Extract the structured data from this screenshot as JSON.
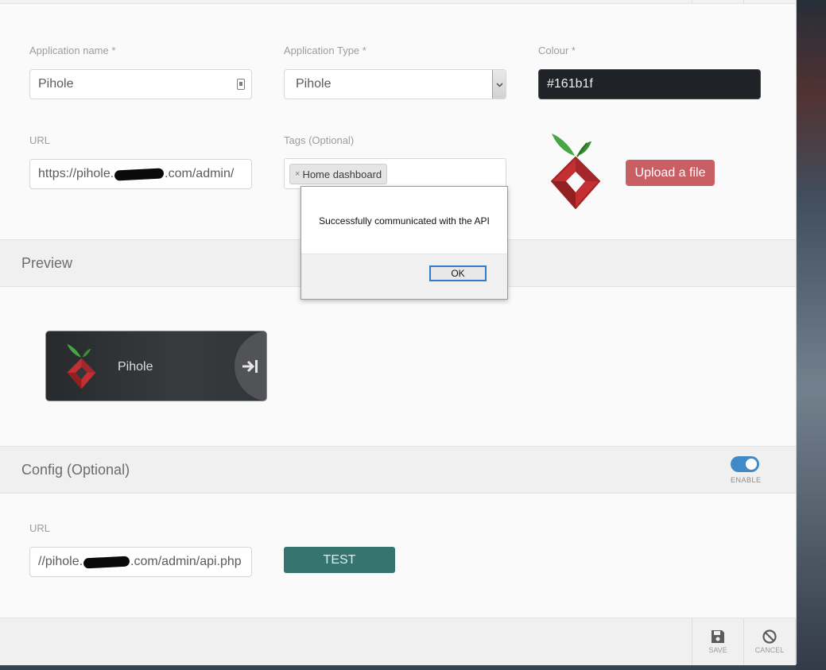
{
  "form": {
    "app_name_label": "Application name *",
    "app_name_value": "Pihole",
    "app_type_label": "Application Type *",
    "app_type_value": "Pihole",
    "colour_label": "Colour *",
    "colour_value": "#161b1f",
    "url_label": "URL",
    "url_prefix": "https://pihole.",
    "url_suffix": ".com/admin/",
    "tags_label": "Tags (Optional)",
    "tags": [
      "Home dashboard"
    ],
    "tag_remove": "×",
    "upload_label": "Upload a file"
  },
  "preview": {
    "section_title": "Preview",
    "tile_name": "Pihole"
  },
  "config": {
    "section_title": "Config (Optional)",
    "toggle_label": "ENABLE",
    "toggle_on": true,
    "url_label": "URL",
    "url_prefix": "//pihole.",
    "url_suffix": ".com/admin/api.php",
    "test_label": "TEST"
  },
  "footer": {
    "save_label": "SAVE",
    "cancel_label": "CANCEL"
  },
  "dialog": {
    "message": "Successfully communicated with the API",
    "ok_label": "OK"
  },
  "colors": {
    "upload_button": "#c7585f",
    "test_button": "#2d6f6a",
    "toggle": "#3a86c8",
    "tile_background": "#161b1f"
  },
  "icons": {
    "app_logo": "pihole-logo-icon",
    "tile_link": "open-link-icon",
    "save": "floppy-disk-icon",
    "cancel": "cancel-circle-icon",
    "field_badge": "id-card-icon",
    "select_arrow": "chevron-down-icon"
  }
}
